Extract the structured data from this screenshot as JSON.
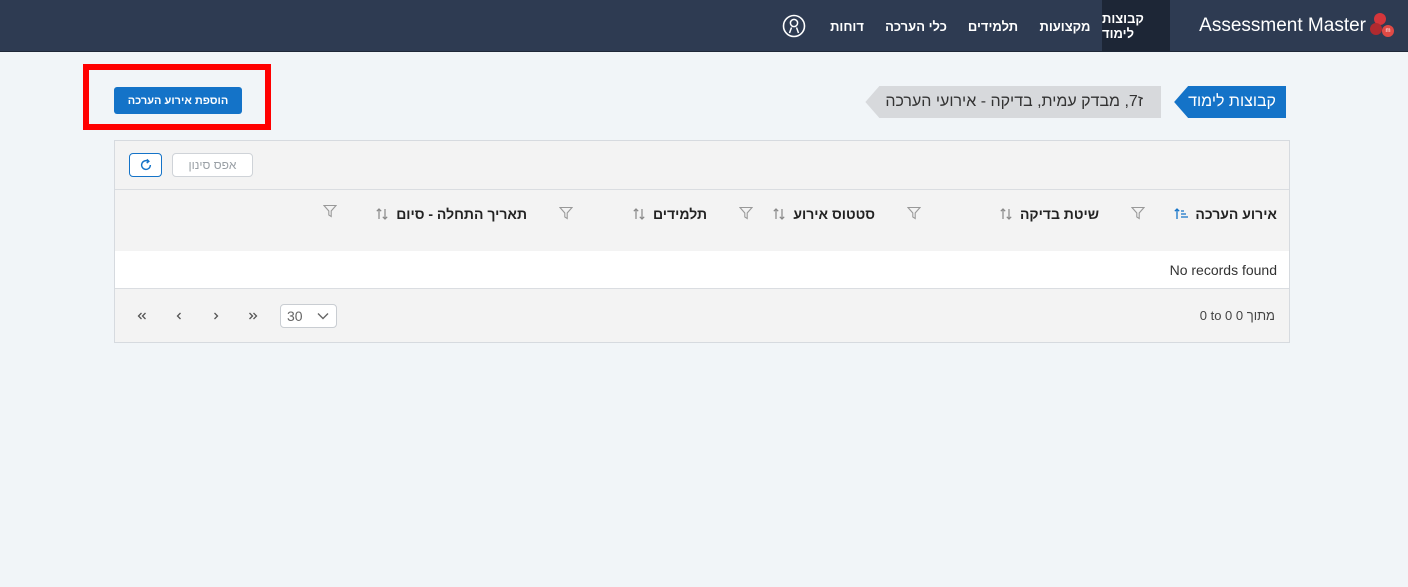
{
  "nav": {
    "brand": "Assessment Master",
    "items": [
      {
        "label": "קבוצות לימוד"
      },
      {
        "label": "מקצועות"
      },
      {
        "label": "תלמידים"
      },
      {
        "label": "כלי הערכה"
      },
      {
        "label": "דוחות"
      }
    ]
  },
  "actions": {
    "add_label": "הוספת אירוע הערכה"
  },
  "breadcrumb": {
    "root": "קבוצות לימוד",
    "current": "ז7, מבדק עמית, בדיקה - אירועי הערכה"
  },
  "grid": {
    "reset_label": "אפס סינון",
    "columns": [
      {
        "label": "אירוע הערכה"
      },
      {
        "label": "שיטת בדיקה"
      },
      {
        "label": "סטטוס אירוע"
      },
      {
        "label": "תלמידים"
      },
      {
        "label": "תאריך התחלה - סיום"
      }
    ],
    "empty_text": "No records found",
    "page_size": "30",
    "pager_info": "0 to 0 מתוך 0"
  },
  "colors": {
    "navbar": "#2e3b52",
    "accent": "#1473c8",
    "highlight": "#ff0000"
  }
}
